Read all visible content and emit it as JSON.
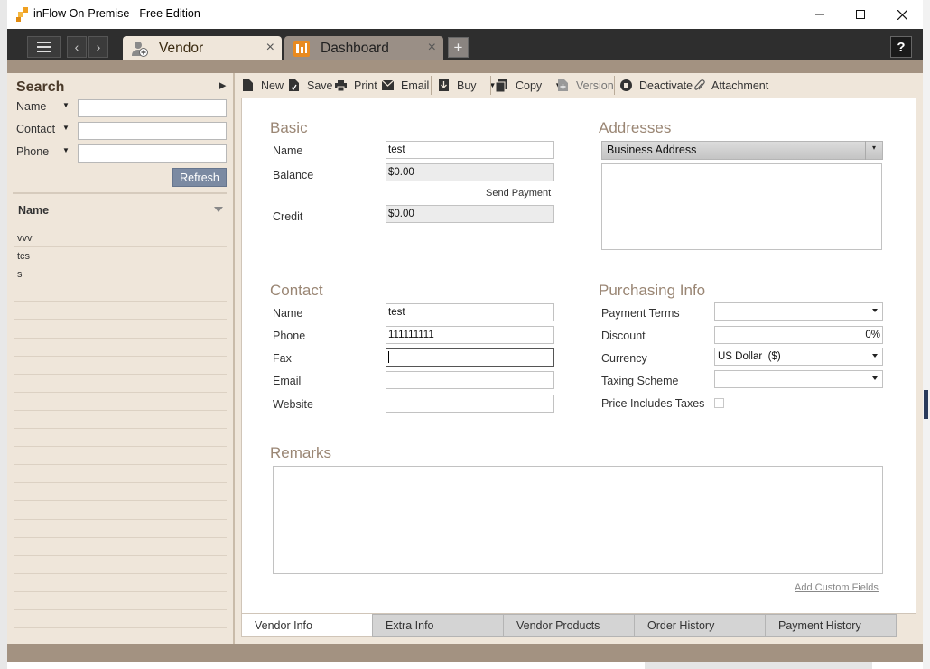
{
  "window": {
    "title": "inFlow On-Premise - Free Edition",
    "controls": {
      "minimize": "minimize-icon",
      "maximize": "maximize-icon",
      "close": "close-icon"
    }
  },
  "tabs": [
    {
      "label": "Vendor",
      "icon": "vendor-person-icon",
      "active": true
    },
    {
      "label": "Dashboard",
      "icon": "dashboard-icon",
      "active": false
    }
  ],
  "help_label": "?",
  "search": {
    "title": "Search",
    "fields": [
      {
        "label": "Name",
        "value": ""
      },
      {
        "label": "Contact",
        "value": ""
      },
      {
        "label": "Phone",
        "value": ""
      }
    ],
    "refresh_label": "Refresh"
  },
  "list": {
    "header": "Name",
    "rows": [
      "vvv",
      "tcs",
      "s",
      "",
      "",
      "",
      "",
      "",
      "",
      "",
      "",
      "",
      "",
      "",
      "",
      "",
      "",
      "",
      "",
      "",
      "",
      "",
      ""
    ]
  },
  "toolbar": {
    "new": "New",
    "save": "Save",
    "print": "Print",
    "email": "Email",
    "buy": "Buy",
    "copy": "Copy",
    "version": "Version",
    "deactivate": "Deactivate",
    "attachment": "Attachment"
  },
  "basic": {
    "title": "Basic",
    "name_label": "Name",
    "name_value": "test",
    "balance_label": "Balance",
    "balance_value": "$0.00",
    "send_payment": "Send Payment",
    "credit_label": "Credit",
    "credit_value": "$0.00"
  },
  "addresses": {
    "title": "Addresses",
    "type": "Business Address",
    "value": ""
  },
  "contact": {
    "title": "Contact",
    "name_label": "Name",
    "name_value": "test",
    "phone_label": "Phone",
    "phone_value": "111111111",
    "fax_label": "Fax",
    "fax_value": "",
    "email_label": "Email",
    "email_value": "",
    "website_label": "Website",
    "website_value": ""
  },
  "purchasing": {
    "title": "Purchasing Info",
    "payment_terms_label": "Payment Terms",
    "payment_terms_value": "",
    "discount_label": "Discount",
    "discount_value": "0%",
    "currency_label": "Currency",
    "currency_value": "US Dollar  ($)",
    "taxing_label": "Taxing Scheme",
    "taxing_value": "",
    "price_includes_taxes_label": "Price Includes Taxes",
    "price_includes_taxes_checked": false
  },
  "remarks": {
    "title": "Remarks",
    "value": ""
  },
  "add_custom_fields": "Add Custom Fields",
  "bottom_tabs": [
    "Vendor Info",
    "Extra Info",
    "Vendor Products",
    "Order History",
    "Payment History"
  ],
  "colors": {
    "accent": "#a39281",
    "panel": "#efe6da",
    "section_title": "#9a8674",
    "refresh": "#7b8aa2"
  }
}
